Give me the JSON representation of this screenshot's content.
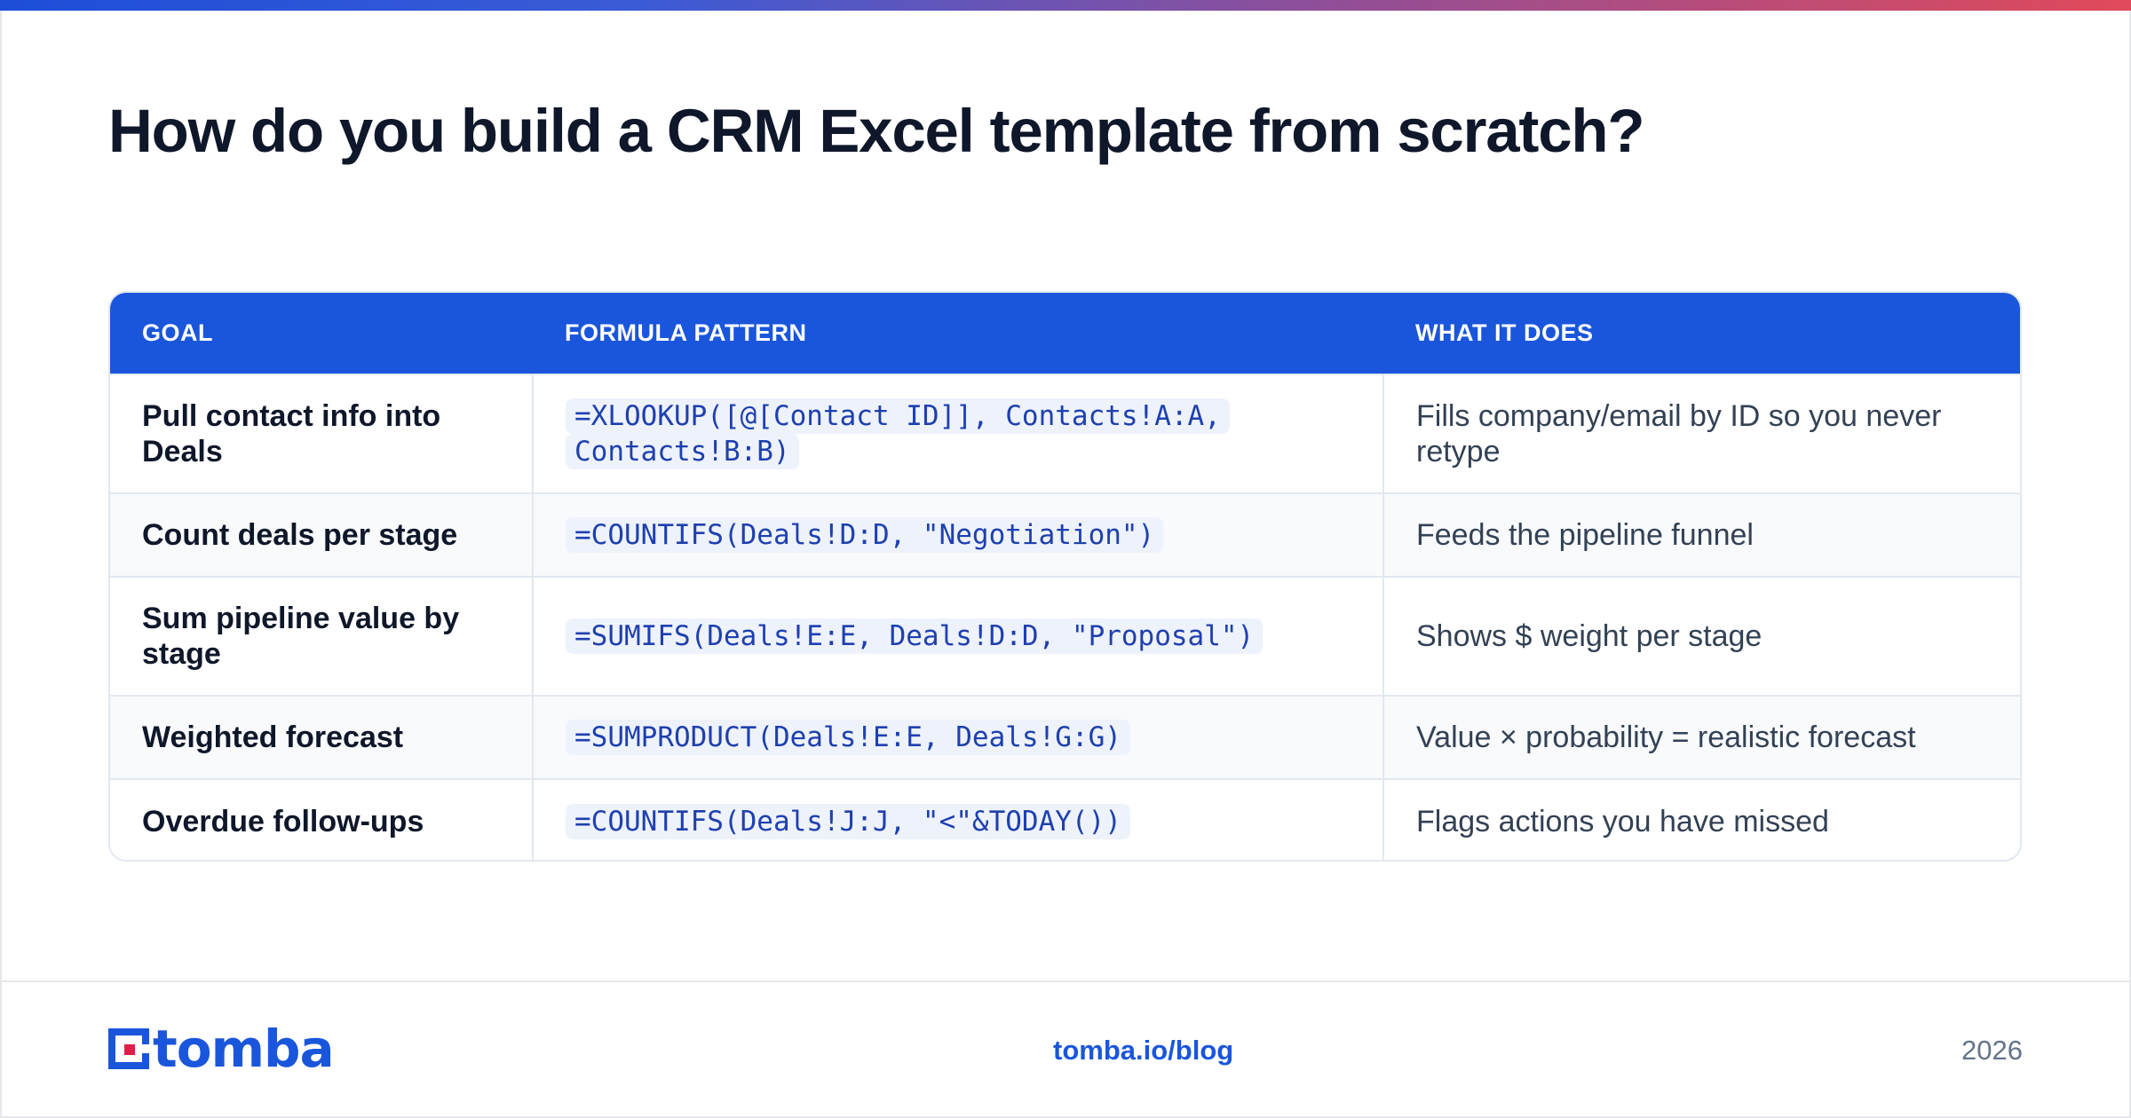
{
  "title": "How do you build a CRM Excel template from scratch?",
  "colors": {
    "header_blue": "#1a56db",
    "accent_gradient": [
      "#1d4ed8",
      "#8b4f9c",
      "#e14a5a"
    ],
    "code_text": "#1e40af",
    "row_alt": "#f8fafc"
  },
  "table": {
    "headers": [
      "GOAL",
      "FORMULA PATTERN",
      "WHAT IT DOES"
    ],
    "rows": [
      {
        "goal": "Pull contact info into Deals",
        "formula": "=XLOOKUP([@[Contact ID]], Contacts!A:A, Contacts!B:B)",
        "does": "Fills company/email by ID so you never retype"
      },
      {
        "goal": "Count deals per stage",
        "formula": "=COUNTIFS(Deals!D:D, \"Negotiation\")",
        "does": "Feeds the pipeline funnel"
      },
      {
        "goal": "Sum pipeline value by stage",
        "formula": "=SUMIFS(Deals!E:E, Deals!D:D, \"Proposal\")",
        "does": "Shows $ weight per stage"
      },
      {
        "goal": "Weighted forecast",
        "formula": "=SUMPRODUCT(Deals!E:E, Deals!G:G)",
        "does": "Value × probability = realistic forecast"
      },
      {
        "goal": "Overdue follow-ups",
        "formula": "=COUNTIFS(Deals!J:J, \"<\"&TODAY())",
        "does": "Flags actions you have missed"
      }
    ]
  },
  "footer": {
    "logo_text": "tomba",
    "logo_icon": "tomba-logo-icon",
    "link": "tomba.io/blog",
    "year": "2026"
  }
}
